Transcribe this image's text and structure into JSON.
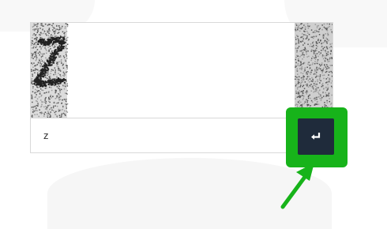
{
  "captcha": {
    "input_value": "z",
    "input_placeholder": ""
  },
  "submit_button": {
    "icon": "enter-return-icon"
  },
  "colors": {
    "highlight": "#17b31a",
    "button_bg": "#1f2b3b",
    "border": "#d9d9d9"
  }
}
